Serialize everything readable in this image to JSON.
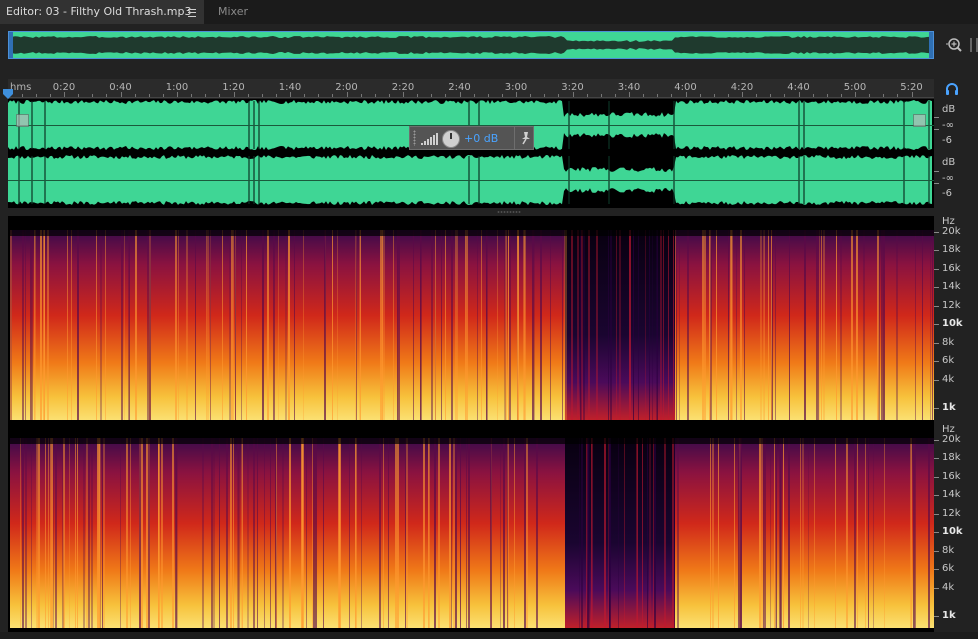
{
  "tabs": {
    "editor_label": "Editor: 03 - Filthy Old Thrash.mp3",
    "mixer_label": "Mixer"
  },
  "timeline": {
    "unit_label": "hms",
    "ticks": [
      "0:20",
      "0:40",
      "1:00",
      "1:20",
      "1:40",
      "2:00",
      "2:20",
      "2:40",
      "3:00",
      "3:20",
      "3:40",
      "4:00",
      "4:20",
      "4:40",
      "5:00",
      "5:20"
    ]
  },
  "hud": {
    "volume_value": "+0 dB"
  },
  "amplitude_scale": {
    "unit": "dB",
    "labels": [
      "-∞",
      "-6"
    ]
  },
  "frequency_scale": {
    "unit": "Hz",
    "labels": [
      "20k",
      "18k",
      "16k",
      "14k",
      "12k",
      "10k",
      "8k",
      "6k",
      "4k",
      "1k"
    ],
    "emphasized": [
      "10k",
      "1k"
    ]
  },
  "colors": {
    "waveform": "#3fd695",
    "accent": "#4aa3ff",
    "selection": "#2f6fb3"
  },
  "icons": [
    "menu-icon",
    "zoom-in-icon",
    "headphones-icon",
    "playhead-icon",
    "volume-meter-icon",
    "volume-knob-icon",
    "pin-icon",
    "fade-handle-icon"
  ]
}
